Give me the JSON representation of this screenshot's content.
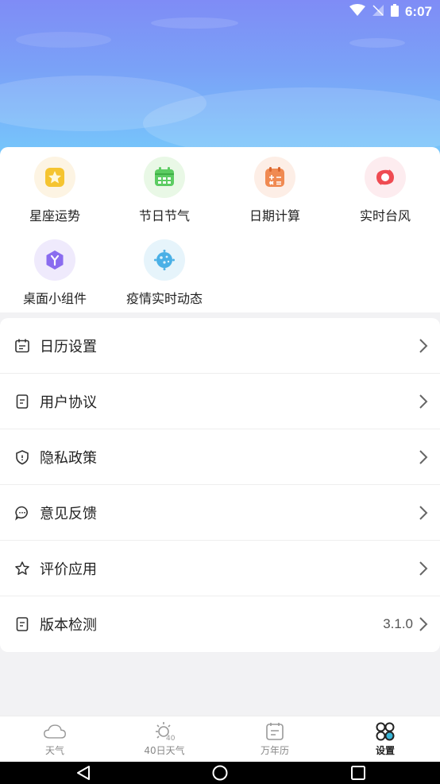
{
  "status_bar": {
    "time": "6:07"
  },
  "shortcuts": [
    {
      "label": "星座运势",
      "icon": "star-constellation-icon",
      "bg": "#fdf4e3",
      "color": "#f5c430"
    },
    {
      "label": "节日节气",
      "icon": "calendar-festival-icon",
      "bg": "#e9f8e6",
      "color": "#5ccc62"
    },
    {
      "label": "日期计算",
      "icon": "date-calculator-icon",
      "bg": "#fdeee6",
      "color": "#f08a52"
    },
    {
      "label": "实时台风",
      "icon": "typhoon-icon",
      "bg": "#fdecef",
      "color": "#ef4b52"
    },
    {
      "label": "桌面小组件",
      "icon": "desktop-widget-icon",
      "bg": "#efeafc",
      "color": "#8a6cef"
    },
    {
      "label": "疫情实时动态",
      "icon": "virus-icon",
      "bg": "#e6f4fb",
      "color": "#4ab0e6"
    }
  ],
  "settings": [
    {
      "label": "日历设置",
      "icon": "calendar-icon"
    },
    {
      "label": "用户协议",
      "icon": "document-icon"
    },
    {
      "label": "隐私政策",
      "icon": "shield-icon"
    },
    {
      "label": "意见反馈",
      "icon": "chat-bubble-icon"
    },
    {
      "label": "评价应用",
      "icon": "star-outline-icon"
    },
    {
      "label": "版本检测",
      "icon": "document-icon",
      "value": "3.1.0"
    }
  ],
  "tabs": [
    {
      "label": "天气",
      "icon": "cloud-icon"
    },
    {
      "label": "40日天气",
      "icon": "sun-40-icon"
    },
    {
      "label": "万年历",
      "icon": "calendar-icon"
    },
    {
      "label": "设置",
      "icon": "grid-settings-icon",
      "active": true
    }
  ],
  "colors": {
    "active_tab": "#222222",
    "inactive_tab": "#999999",
    "chevron": "#666666"
  }
}
